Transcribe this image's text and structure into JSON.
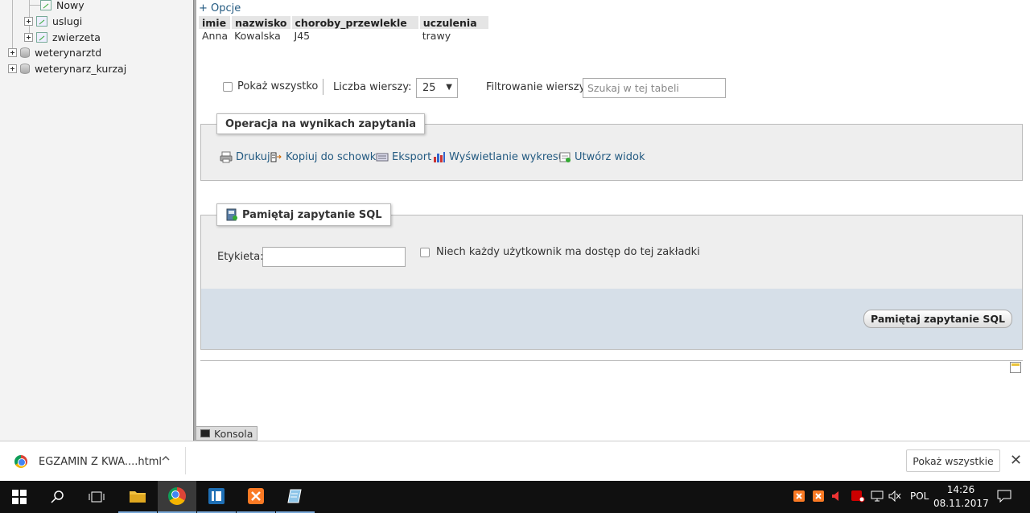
{
  "nav": {
    "items": [
      {
        "label": "Nowy"
      },
      {
        "label": "uslugi"
      },
      {
        "label": "zwierzeta"
      },
      {
        "label": "weterynarztd"
      },
      {
        "label": "weterynarz_kurzaj"
      }
    ]
  },
  "results": {
    "options_link": "+ Opcje",
    "columns": [
      "imie",
      "nazwisko",
      "choroby_przewlekle",
      "uczulenia"
    ],
    "rows": [
      [
        "Anna",
        "Kowalska",
        "J45",
        "trawy"
      ]
    ]
  },
  "controls": {
    "show_all": "Pokaż wszystko",
    "rows_label": "Liczba wierszy:",
    "rows_value": "25",
    "filter_label": "Filtrowanie wierszy:",
    "filter_placeholder": "Szukaj w tej tabeli"
  },
  "query_ops": {
    "legend": "Operacja na wynikach zapytania",
    "print": "Drukuj",
    "copy": "Kopiuj do schowka",
    "export": "Eksport",
    "chart": "Wyświetlanie wykresu",
    "create_view": "Utwórz widok"
  },
  "bookmark": {
    "legend": "Pamiętaj zapytanie SQL",
    "label": "Etykieta:",
    "label_value": "",
    "share": "Niech każdy użytkownik ma dostęp do tej zakładki",
    "button": "Pamiętaj zapytanie SQL"
  },
  "console": {
    "label": "Konsola"
  },
  "download_bar": {
    "file": "EGZAMIN Z KWA....html",
    "show_all": "Pokaż wszystkie",
    "close": "✕"
  },
  "taskbar": {
    "language": "POL",
    "time": "14:26",
    "date": "08.11.2017"
  }
}
